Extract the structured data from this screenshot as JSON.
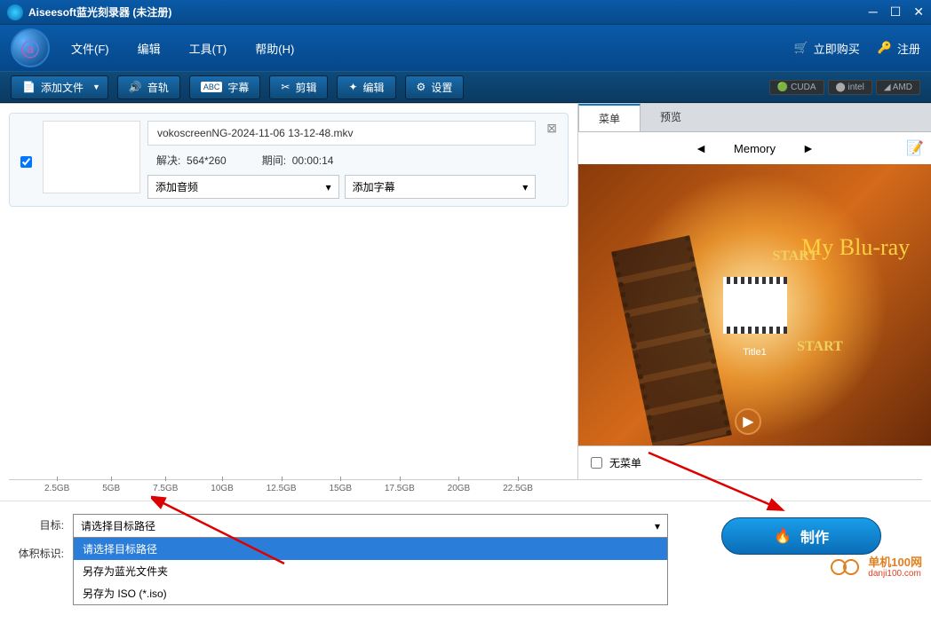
{
  "titlebar": {
    "title": "Aiseesoft蓝光刻录器 (未注册)"
  },
  "menu": {
    "file": "文件(F)",
    "edit": "编辑",
    "tools": "工具(T)",
    "help": "帮助(H)",
    "buy_now": "立即购买",
    "register": "注册"
  },
  "toolbar": {
    "add_file": "添加文件",
    "audio": "音轨",
    "subtitle": "字幕",
    "crop": "剪辑",
    "edit": "编辑",
    "settings": "设置",
    "cuda": "CUDA",
    "intel": "intel",
    "amd": "AMD"
  },
  "file": {
    "name": "vokoscreenNG-2024-11-06 13-12-48.mkv",
    "resolve_label": "解决:",
    "resolve_value": "564*260",
    "duration_label": "期间:",
    "duration_value": "00:00:14",
    "add_audio": "添加音频",
    "add_subtitle": "添加字幕"
  },
  "tabs": {
    "menu": "菜单",
    "preview": "预览"
  },
  "nav": {
    "label": "Memory"
  },
  "preview": {
    "start": "START",
    "bluray": "My Blu-ray",
    "title1": "Title1"
  },
  "no_menu": "无菜单",
  "scale": [
    "2.5GB",
    "5GB",
    "7.5GB",
    "10GB",
    "12.5GB",
    "15GB",
    "17.5GB",
    "20GB",
    "22.5GB"
  ],
  "form": {
    "target_label": "目标:",
    "target_placeholder": "请选择目标路径",
    "options": {
      "sel": "请选择目标路径",
      "folder": "另存为蓝光文件夹",
      "iso": "另存为 ISO (*.iso)"
    },
    "volume_label": "体积标识:"
  },
  "create_btn": "制作",
  "watermark": {
    "cn": "单机100网",
    "url": "danji100.com"
  }
}
